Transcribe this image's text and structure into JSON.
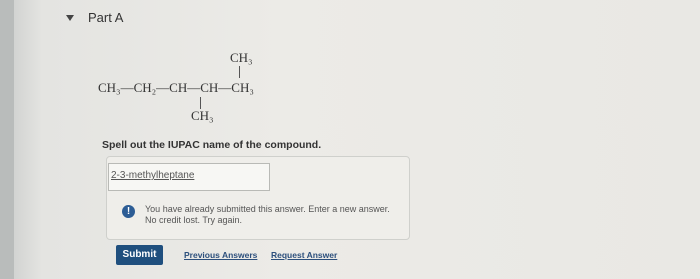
{
  "part": {
    "title": "Part A"
  },
  "structure": {
    "top_substituent": "CH₃",
    "main_chain": "CH₃—CH₂—CH—CH—CH₃",
    "bottom_substituent": "CH₃"
  },
  "question": {
    "prompt": "Spell out the IUPAC name of the compound."
  },
  "answer": {
    "value": "2-3-methylheptane"
  },
  "feedback": {
    "icon": "info-icon",
    "line1": "You have already submitted this answer. Enter a new answer.",
    "line2": "No credit lost. Try again."
  },
  "actions": {
    "submit_label": "Submit",
    "previous_answers_label": "Previous Answers",
    "request_answer_label": "Request Answer"
  },
  "colors": {
    "submit": "#1f4f7e",
    "info": "#2d5d95",
    "link": "#2c4f7c"
  }
}
